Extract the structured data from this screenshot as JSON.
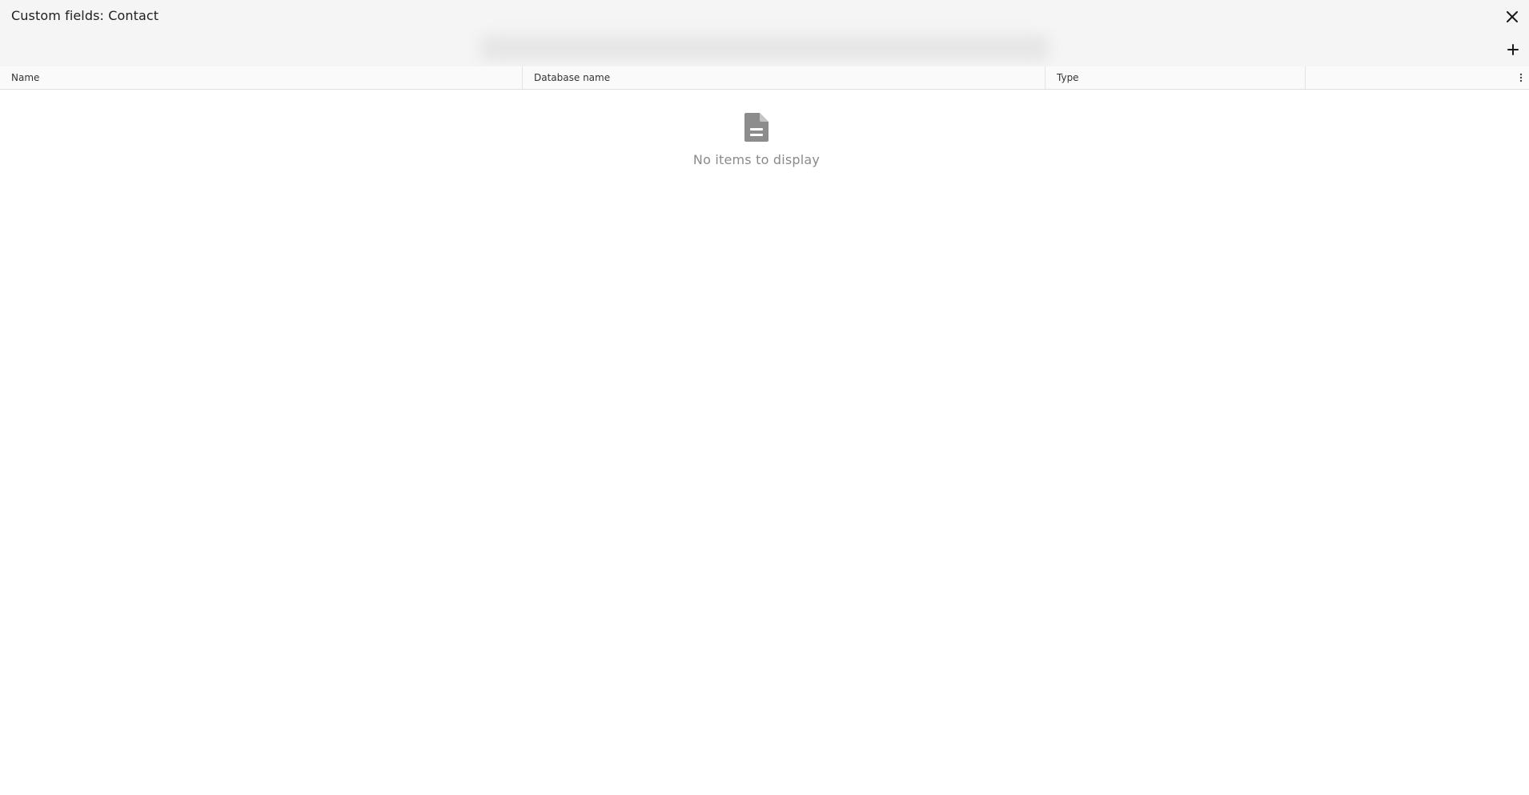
{
  "window": {
    "title": "Custom fields: Contact"
  },
  "toolbar": {
    "close_icon": "close-icon",
    "add_icon": "plus-icon"
  },
  "table": {
    "columns": [
      {
        "label": "Name"
      },
      {
        "label": "Database name"
      },
      {
        "label": "Type"
      }
    ],
    "column_menu_icon": "vertical-dots-icon"
  },
  "empty_state": {
    "icon": "document-icon",
    "message": "No items to display"
  },
  "colors": {
    "header_bg": "#f5f5f5",
    "icon_gray": "#8c8c8c",
    "muted_text": "#8a8a8a"
  }
}
